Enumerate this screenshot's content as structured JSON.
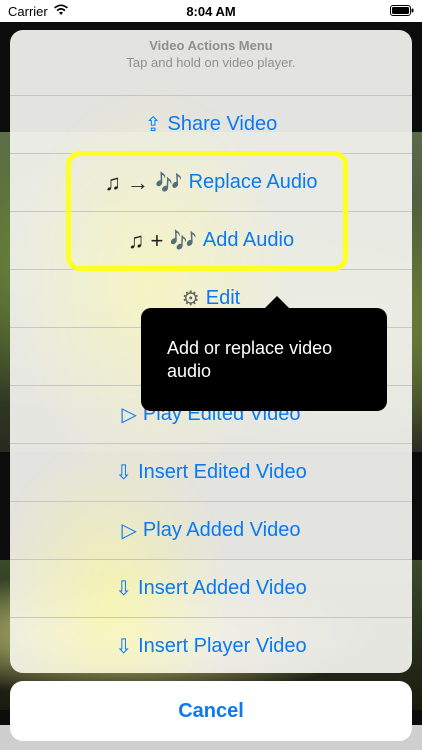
{
  "status_bar": {
    "carrier": "Carrier",
    "time": "8:04 AM",
    "icons": [
      "wifi-icon",
      "battery-icon"
    ]
  },
  "sheet": {
    "title": "Video Actions Menu",
    "subtitle": "Tap and hold on video player.",
    "actions": [
      {
        "icon": "⇪",
        "label": "Share Video"
      },
      {
        "icon": "♫ → 🎶",
        "label": "Replace Audio"
      },
      {
        "icon": "♫ + 🎶",
        "label": "Add Audio"
      },
      {
        "icon": "⚙",
        "label": "Edit"
      },
      {
        "icon": "▷",
        "label": "Play Edited Video"
      },
      {
        "icon": "⇩",
        "label": "Insert Edited Video"
      },
      {
        "icon": "▷",
        "label": "Play Added Video"
      },
      {
        "icon": "⇩",
        "label": "Insert Added Video"
      },
      {
        "icon": "⇩",
        "label": "Insert Player Video"
      }
    ],
    "cancel_label": "Cancel"
  },
  "tooltip": {
    "text": "Add or replace video audio"
  },
  "colors": {
    "accent": "#0a79f2",
    "highlight": "#ffff22",
    "tooltip_bg": "#000000"
  }
}
